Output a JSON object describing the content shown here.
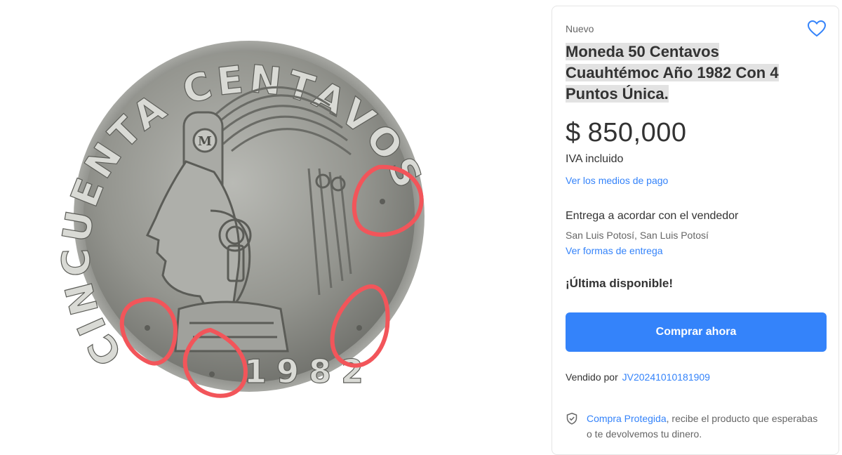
{
  "product": {
    "condition": "Nuevo",
    "title": "Moneda 50 Centavos Cuauhtémoc Año 1982 Con 4 Puntos Única.",
    "price_symbol": "$",
    "price_value": "850,000",
    "tax_note": "IVA incluido",
    "payment_link": "Ver los medios de pago",
    "favorite_icon": "heart-icon"
  },
  "delivery": {
    "title": "Entrega a acordar con el vendedor",
    "location": "San Luis Potosí, San Luis Potosí",
    "link": "Ver formas de entrega"
  },
  "stock": {
    "label": "¡Última disponible!"
  },
  "buy_button": {
    "label": "Comprar ahora"
  },
  "seller": {
    "prefix": "Vendido por",
    "name": "JV20241010181909"
  },
  "protection": {
    "icon": "shield-check-icon",
    "link": "Compra Protegida",
    "text": ", recibe el producto que esperabas o te devolvemos tu dinero."
  },
  "coin_image": {
    "top_legend": "CINCUENTA CENTAVOS",
    "year": "1982",
    "mint_mark": "M",
    "circle_color": "#f2555a",
    "accent_color": "#3483fa"
  }
}
